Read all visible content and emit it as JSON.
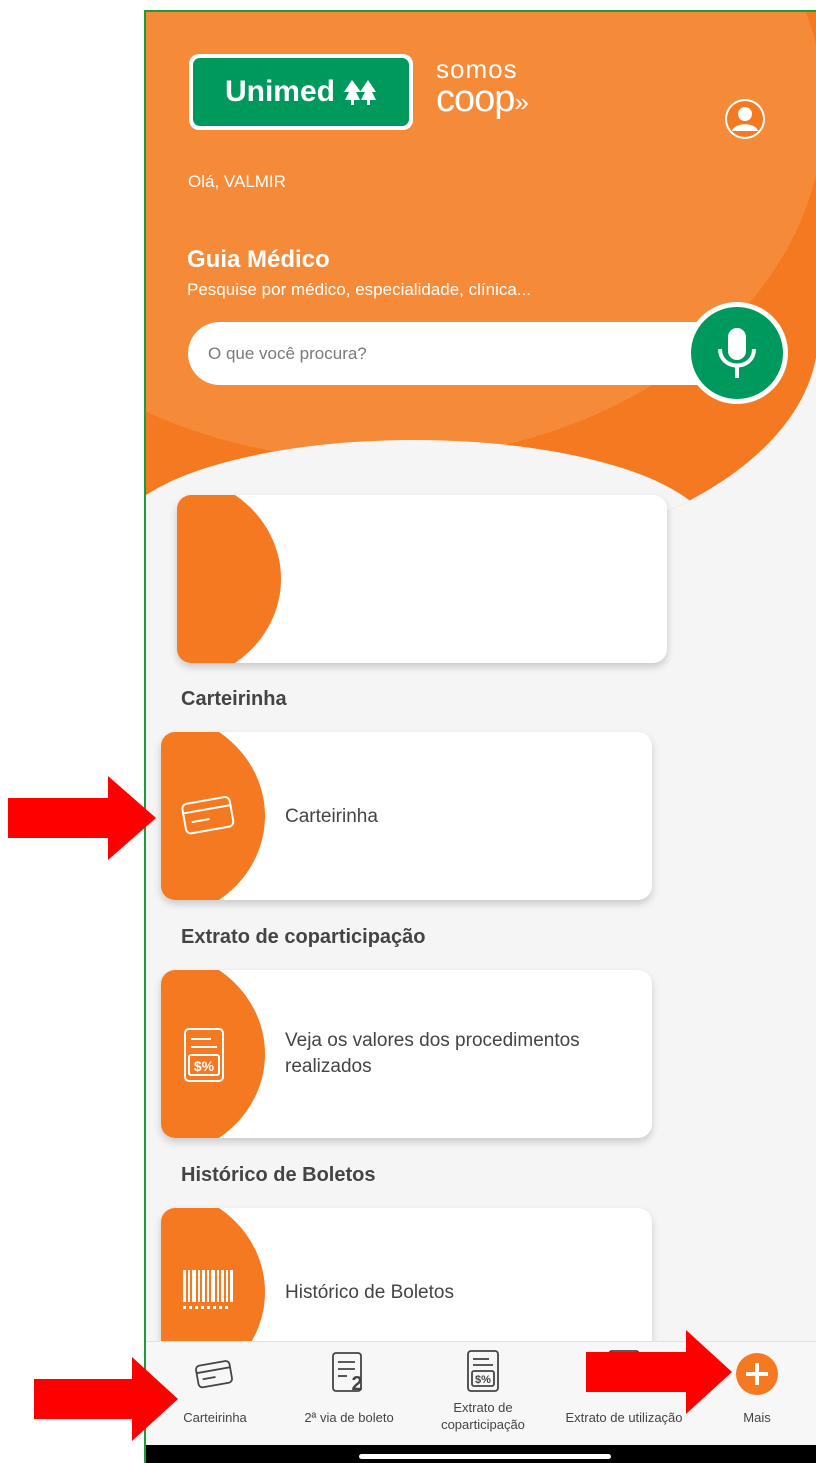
{
  "brand": {
    "logo_text": "Unimed",
    "coop_top": "somos",
    "coop_bottom": "coop",
    "colors": {
      "orange": "#f47920",
      "green": "#00995d",
      "arrow": "#ff0000"
    }
  },
  "header": {
    "greeting": "Olá, VALMIR",
    "guia_title": "Guia Médico",
    "guia_subtitle": "Pesquise por médico, especialidade, clínica...",
    "profile_icon": "user-profile-icon"
  },
  "search": {
    "placeholder": "O que você procura?",
    "value": "",
    "mic_icon": "microphone-icon"
  },
  "sections": [
    {
      "title": "Carteirinha",
      "card_text": "Carteirinha",
      "icon": "card-icon"
    },
    {
      "title": "Extrato de coparticipação",
      "card_text": "Veja os valores dos procedimentos realizados",
      "icon": "receipt-percent-icon"
    },
    {
      "title": "Histórico de Boletos",
      "card_text": "Histórico de Boletos",
      "icon": "barcode-icon"
    }
  ],
  "bottom_nav": [
    {
      "label": "Carteirinha",
      "icon": "card-icon"
    },
    {
      "label": "2ª via de boleto",
      "icon": "document-2-icon"
    },
    {
      "label": "Extrato de coparticipação",
      "icon": "receipt-percent-icon"
    },
    {
      "label": "Extrato de utilização",
      "icon": "document-icon"
    },
    {
      "label": "Mais",
      "icon": "plus-circle-icon"
    }
  ]
}
